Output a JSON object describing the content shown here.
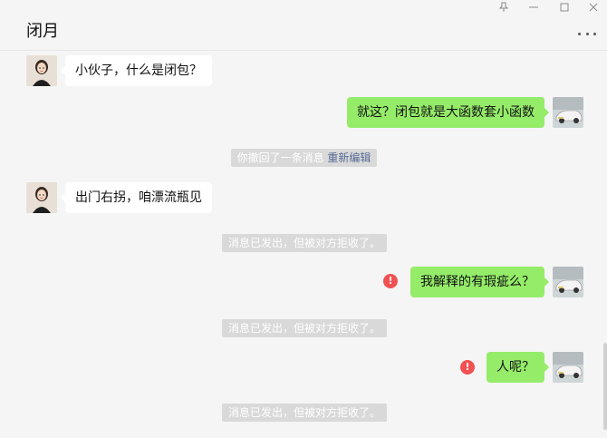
{
  "window": {
    "title": "闭月",
    "controls": {
      "pin_icon": "pin-icon",
      "minimize_icon": "minimize-icon",
      "maximize_icon": "maximize-icon",
      "close_icon": "close-icon",
      "more_icon": "more-icon"
    }
  },
  "messages": {
    "m1": {
      "text": "小伙子，什么是闭包？"
    },
    "m2": {
      "text": "就这？闭包就是大函数套小函数"
    },
    "n1": {
      "text": "你撤回了一条消息",
      "link": "重新编辑"
    },
    "m3": {
      "text": "出门右拐，咱漂流瓶见"
    },
    "n2": {
      "text": "消息已发出，但被对方拒收了。"
    },
    "m4": {
      "text": "我解释的有瑕疵么？"
    },
    "n3": {
      "text": "消息已发出，但被对方拒收了。"
    },
    "m5": {
      "text": "人呢？"
    },
    "n4": {
      "text": "消息已发出，但被对方拒收了。"
    }
  },
  "icons": {
    "error_glyph": "!"
  },
  "colors": {
    "sent_bubble": "#95ec69",
    "received_bubble": "#ffffff",
    "error_red": "#f15151",
    "link_blue": "#576b95",
    "background": "#f5f5f5"
  }
}
